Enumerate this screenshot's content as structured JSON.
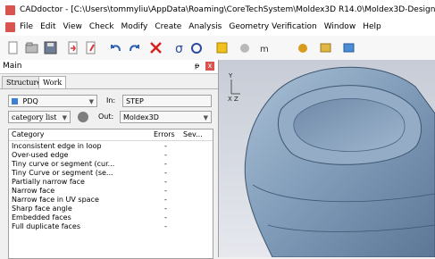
{
  "window": {
    "title": "CADdoctor - [C:\\Users\\tommyliu\\AppData\\Roaming\\CoreTechSystem\\Moldex3D R14.0\\Moldex3D-Designer\\c"
  },
  "menu": [
    "File",
    "Edit",
    "View",
    "Check",
    "Modify",
    "Create",
    "Analysis",
    "Geometry Verification",
    "Window",
    "Help"
  ],
  "toolbar_icons": [
    "new-icon",
    "open-icon",
    "save-icon",
    "import-icon",
    "export-icon",
    "undo-icon",
    "redo-icon",
    "delete-icon",
    "rotate-icon",
    "orbit-icon",
    "shaded-icon",
    "wire-icon",
    "measure-icon",
    "gear-icon",
    "tools-icon",
    "user-icon"
  ],
  "panel": {
    "title": "Main",
    "pin": "ᵽ",
    "close": "x",
    "tabs": [
      "Structure",
      "Work"
    ],
    "active_tab": "Work"
  },
  "work": {
    "pdq_value": "PDQ",
    "in_label": "In:",
    "in_value": "STEP",
    "category_select": "category list",
    "out_label": "Out:",
    "out_value": "Moldex3D",
    "columns": [
      "Category",
      "Errors",
      "Sev..."
    ],
    "rows": [
      {
        "category": "Inconsistent edge in loop",
        "errors": "-"
      },
      {
        "category": "Over-used edge",
        "errors": "-"
      },
      {
        "category": "Tiny curve or segment (cur...",
        "errors": "-"
      },
      {
        "category": "Tiny Curve or segment (se...",
        "errors": "-"
      },
      {
        "category": "Partially narrow face",
        "errors": "-"
      },
      {
        "category": "Narrow face",
        "errors": "-"
      },
      {
        "category": "Narrow face in UV space",
        "errors": "-"
      },
      {
        "category": "Sharp face angle",
        "errors": "-"
      },
      {
        "category": "Embedded faces",
        "errors": "-"
      },
      {
        "category": "Full duplicate faces",
        "errors": "-"
      }
    ]
  },
  "viewport": {
    "axis_y": "Y",
    "axis_xz": "X Z"
  },
  "colors": {
    "accent": "#d9534f",
    "model": "#7f9bb8"
  }
}
